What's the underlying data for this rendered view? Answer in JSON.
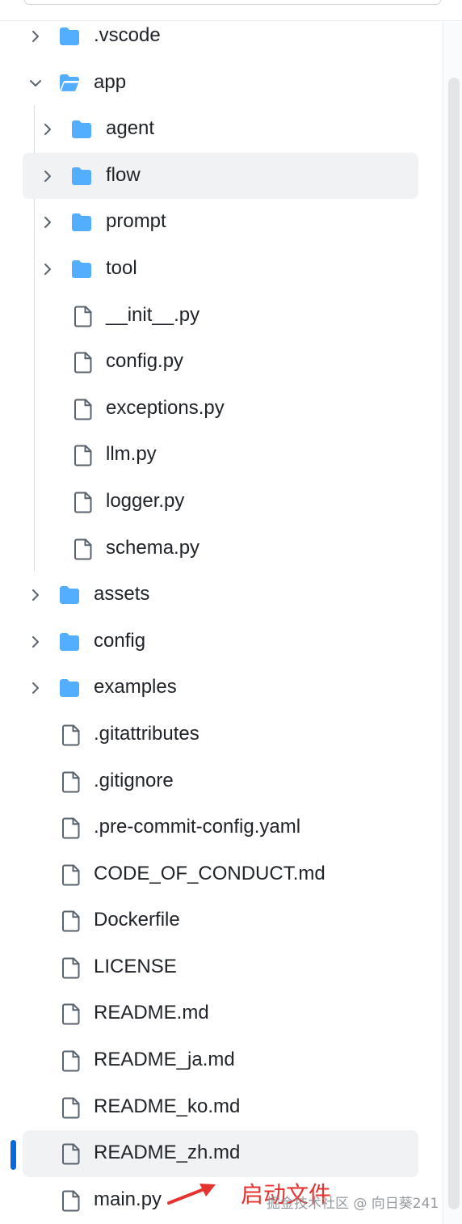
{
  "tree": [
    {
      "label": ".vscode",
      "type": "folder",
      "depth": 0,
      "expanded": false
    },
    {
      "label": "app",
      "type": "folder",
      "depth": 0,
      "expanded": true
    },
    {
      "label": "agent",
      "type": "folder",
      "depth": 1,
      "expanded": false
    },
    {
      "label": "flow",
      "type": "folder",
      "depth": 1,
      "expanded": false,
      "hover": true
    },
    {
      "label": "prompt",
      "type": "folder",
      "depth": 1,
      "expanded": false
    },
    {
      "label": "tool",
      "type": "folder",
      "depth": 1,
      "expanded": false
    },
    {
      "label": "__init__.py",
      "type": "file",
      "depth": 1
    },
    {
      "label": "config.py",
      "type": "file",
      "depth": 1
    },
    {
      "label": "exceptions.py",
      "type": "file",
      "depth": 1
    },
    {
      "label": "llm.py",
      "type": "file",
      "depth": 1
    },
    {
      "label": "logger.py",
      "type": "file",
      "depth": 1
    },
    {
      "label": "schema.py",
      "type": "file",
      "depth": 1
    },
    {
      "label": "assets",
      "type": "folder",
      "depth": 0,
      "expanded": false
    },
    {
      "label": "config",
      "type": "folder",
      "depth": 0,
      "expanded": false
    },
    {
      "label": "examples",
      "type": "folder",
      "depth": 0,
      "expanded": false
    },
    {
      "label": ".gitattributes",
      "type": "file",
      "depth": 0
    },
    {
      "label": ".gitignore",
      "type": "file",
      "depth": 0
    },
    {
      "label": ".pre-commit-config.yaml",
      "type": "file",
      "depth": 0
    },
    {
      "label": "CODE_OF_CONDUCT.md",
      "type": "file",
      "depth": 0
    },
    {
      "label": "Dockerfile",
      "type": "file",
      "depth": 0
    },
    {
      "label": "LICENSE",
      "type": "file",
      "depth": 0
    },
    {
      "label": "README.md",
      "type": "file",
      "depth": 0
    },
    {
      "label": "README_ja.md",
      "type": "file",
      "depth": 0
    },
    {
      "label": "README_ko.md",
      "type": "file",
      "depth": 0
    },
    {
      "label": "README_zh.md",
      "type": "file",
      "depth": 0,
      "active": true
    },
    {
      "label": "main.py",
      "type": "file",
      "depth": 0
    }
  ],
  "icons": {
    "folder": "folder-icon",
    "folder_open": "folder-open-icon",
    "file": "file-icon",
    "chevron_right": "chevron-right-icon",
    "chevron_down": "chevron-down-icon"
  },
  "colors": {
    "folder": "#54aeff",
    "active_marker": "#0969da",
    "annotation": "#e5342f"
  },
  "annotation": {
    "text": "启动文件",
    "watermark": "掘金技术社区 @ 向日葵241"
  }
}
